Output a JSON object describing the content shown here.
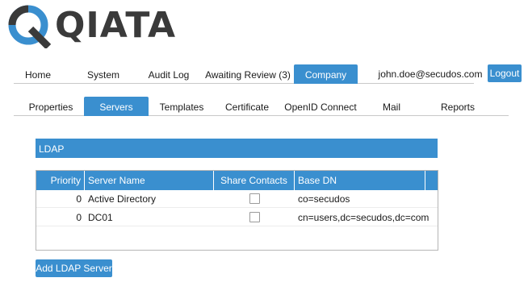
{
  "logo": {
    "text": "QIATA"
  },
  "main_nav": {
    "tabs": [
      {
        "label": "Home"
      },
      {
        "label": "System"
      },
      {
        "label": "Audit Log"
      },
      {
        "label": "Awaiting Review (3)"
      },
      {
        "label": "Company",
        "active": true
      }
    ],
    "user_email": "john.doe@secudos.com",
    "logout_label": "Logout"
  },
  "sub_nav": {
    "tabs": [
      {
        "label": "Properties"
      },
      {
        "label": "Servers",
        "active": true
      },
      {
        "label": "Templates"
      },
      {
        "label": "Certificate"
      },
      {
        "label": "OpenID Connect"
      },
      {
        "label": "Mail"
      },
      {
        "label": "Reports"
      }
    ]
  },
  "ldap": {
    "title": "LDAP",
    "columns": [
      "Priority",
      "Server Name",
      "Share Contacts",
      "Base DN"
    ],
    "rows": [
      {
        "priority": "0",
        "server_name": "Active Directory",
        "share_contacts": false,
        "base_dn": "co=secudos"
      },
      {
        "priority": "0",
        "server_name": "DC01",
        "share_contacts": false,
        "base_dn": "cn=users,dc=secudos,dc=com"
      }
    ],
    "add_button_label": "Add LDAP Server"
  },
  "colors": {
    "accent": "#3a8fcf",
    "text": "#1a1a1a",
    "logo_text": "#3a3a3a"
  }
}
